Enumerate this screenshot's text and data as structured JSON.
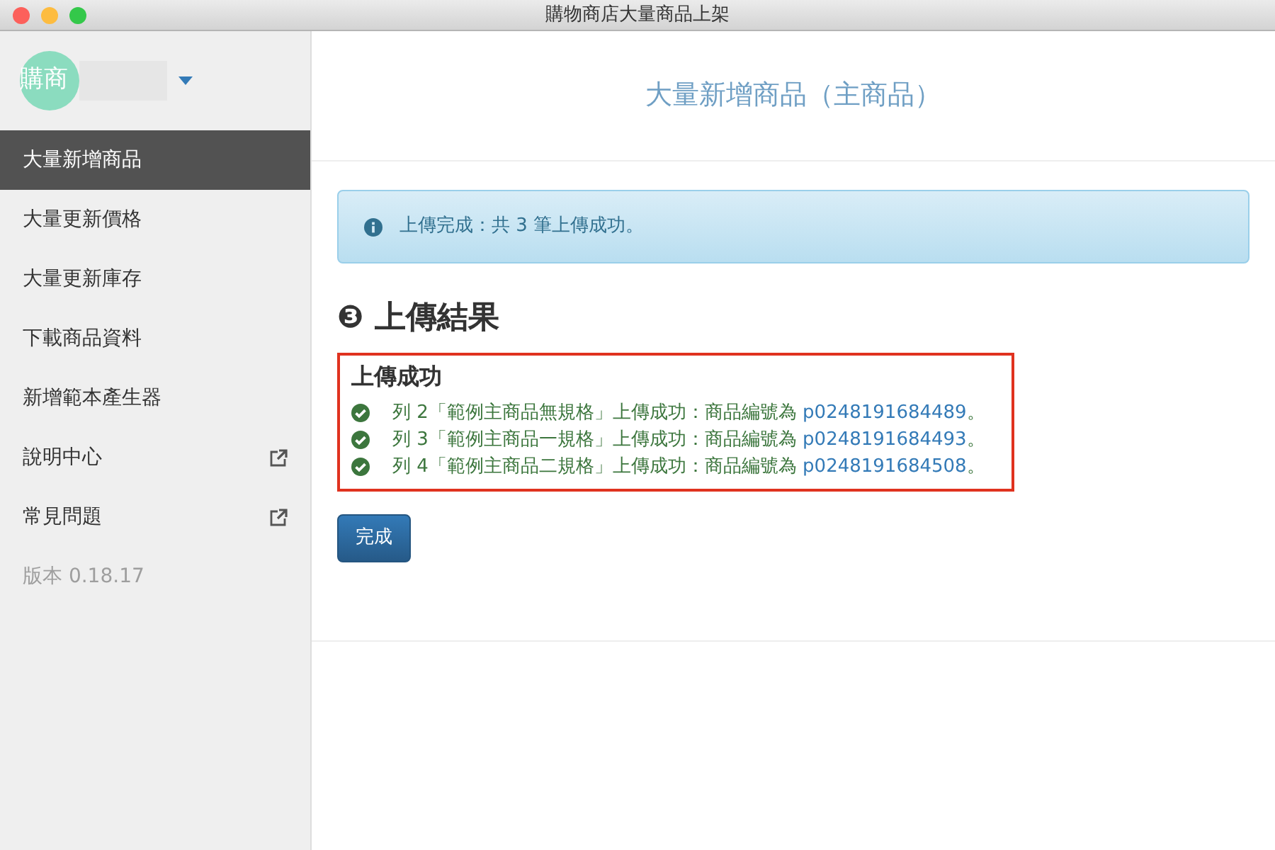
{
  "window": {
    "title": "購物商店大量商品上架"
  },
  "account": {
    "avatar_text": "購商"
  },
  "sidebar": {
    "items": [
      {
        "label": "大量新增商品",
        "selected": true,
        "external": false
      },
      {
        "label": "大量更新價格",
        "selected": false,
        "external": false
      },
      {
        "label": "大量更新庫存",
        "selected": false,
        "external": false
      },
      {
        "label": "下載商品資料",
        "selected": false,
        "external": false
      },
      {
        "label": "新增範本產生器",
        "selected": false,
        "external": false
      },
      {
        "label": "說明中心",
        "selected": false,
        "external": true
      },
      {
        "label": "常見問題",
        "selected": false,
        "external": true
      }
    ],
    "version": "版本 0.18.17"
  },
  "header": {
    "title": "大量新增商品（主商品）"
  },
  "alert": {
    "text": "上傳完成：共 3 筆上傳成功。"
  },
  "section": {
    "step": "❸",
    "heading": "上傳結果"
  },
  "results": {
    "title": "上傳成功",
    "items": [
      {
        "text": "列 2「範例主商品無規格」上傳成功：商品編號為 ",
        "code": "p0248191684489",
        "suffix": "。"
      },
      {
        "text": "列 3「範例主商品一規格」上傳成功：商品編號為 ",
        "code": "p0248191684493",
        "suffix": "。"
      },
      {
        "text": "列 4「範例主商品二規格」上傳成功：商品編號為 ",
        "code": "p0248191684508",
        "suffix": "。"
      }
    ]
  },
  "button": {
    "label": "完成"
  }
}
